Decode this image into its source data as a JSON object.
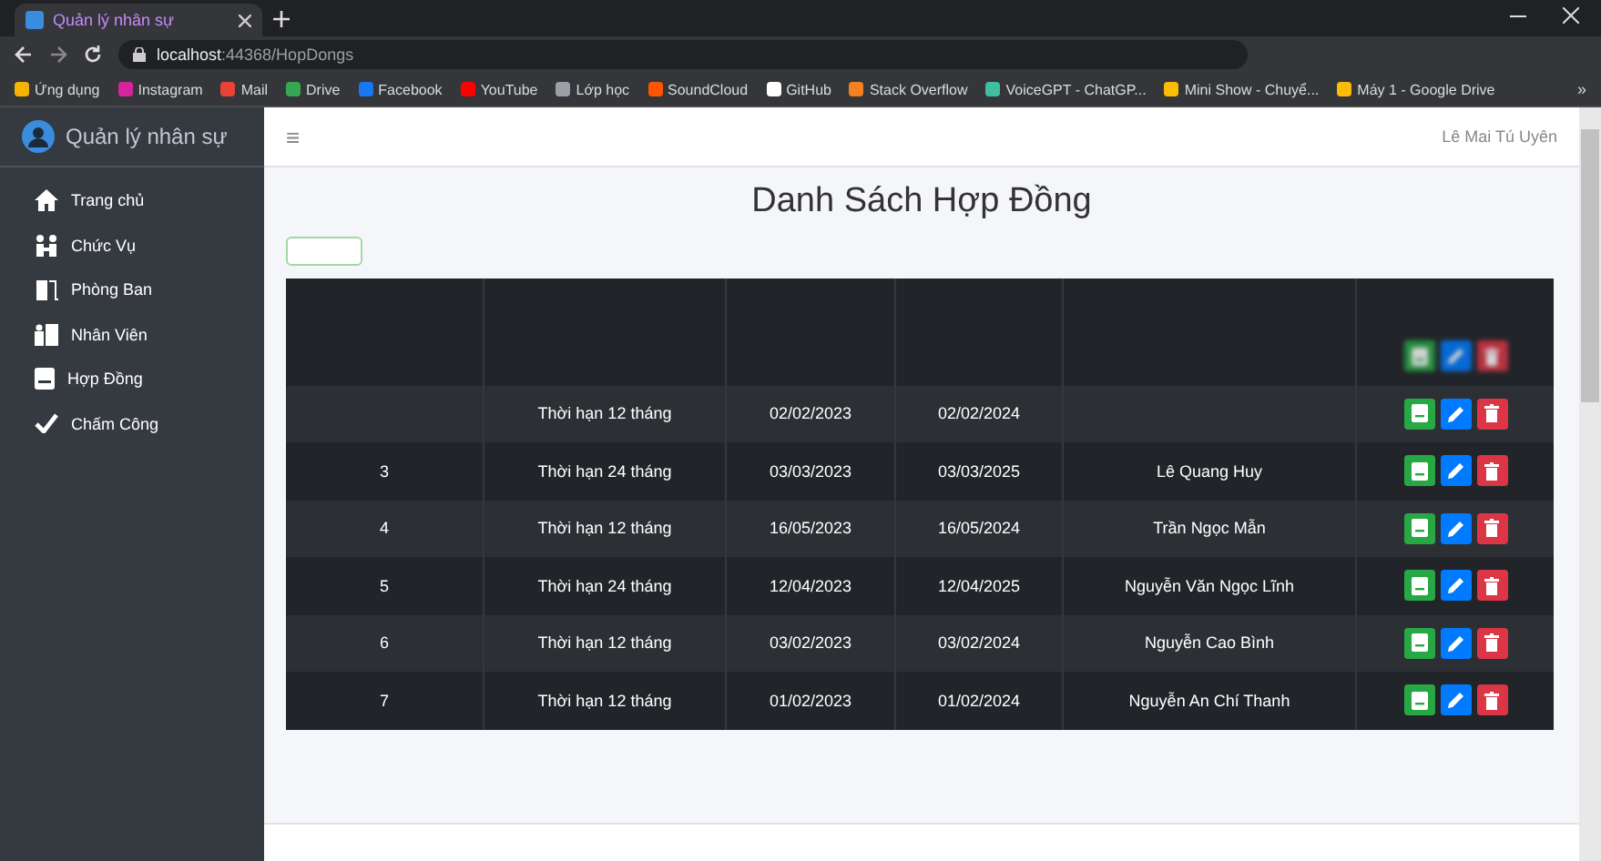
{
  "browser": {
    "tab_title": "Quản lý nhân sự",
    "url_host": "localhost",
    "url_path": ":44368/HopDongs",
    "bookmarks": [
      {
        "label": "Ứng dụng",
        "color": "#f4b400"
      },
      {
        "label": "Instagram",
        "color": "#d6249f"
      },
      {
        "label": "Mail",
        "color": "#ea4335"
      },
      {
        "label": "Drive",
        "color": "#34a853"
      },
      {
        "label": "Facebook",
        "color": "#1877f2"
      },
      {
        "label": "YouTube",
        "color": "#ff0000"
      },
      {
        "label": "Lớp học",
        "color": "#9aa0a6"
      },
      {
        "label": "SoundCloud",
        "color": "#ff5500"
      },
      {
        "label": "GitHub",
        "color": "#ffffff"
      },
      {
        "label": "Stack Overflow",
        "color": "#f48024"
      },
      {
        "label": "VoiceGPT - ChatGP...",
        "color": "#3fbf9f"
      },
      {
        "label": "Mini Show - Chuyể...",
        "color": "#fbbc04"
      },
      {
        "label": "Máy 1 - Google Drive",
        "color": "#fbbc05"
      }
    ],
    "more": "»"
  },
  "sidebar": {
    "brand": "Quản lý nhân sự",
    "items": [
      {
        "label": "Trang chủ",
        "kind": "home"
      },
      {
        "label": "Chức Vụ",
        "kind": "people"
      },
      {
        "label": "Phòng Ban",
        "kind": "door"
      },
      {
        "label": "Nhân Viên",
        "kind": "staff"
      },
      {
        "label": "Hợp Đồng",
        "kind": "book"
      },
      {
        "label": "Chấm Công",
        "kind": "check"
      }
    ]
  },
  "navbar": {
    "menu": "≡",
    "user": "Lê Mai Tú Uyên"
  },
  "page": {
    "title": "Danh Sách Hợp Đồng"
  },
  "table": {
    "rows": [
      {
        "blurred": true
      },
      {
        "type": "Thời hạn 12 tháng",
        "start": "02/02/2023",
        "end": "02/02/2024"
      },
      {
        "id": "3",
        "type": "Thời hạn 24 tháng",
        "start": "03/03/2023",
        "end": "03/03/2025",
        "employee": "Lê Quang Huy"
      },
      {
        "id": "4",
        "type": "Thời hạn 12 tháng",
        "start": "16/05/2023",
        "end": "16/05/2024",
        "employee": "Trần Ngọc Mẫn"
      },
      {
        "id": "5",
        "type": "Thời hạn 24 tháng",
        "start": "12/04/2023",
        "end": "12/04/2025",
        "employee": "Nguyễn Văn Ngọc Lĩnh"
      },
      {
        "id": "6",
        "type": "Thời hạn 12 tháng",
        "start": "03/02/2023",
        "end": "03/02/2024",
        "employee": "Nguyễn Cao Bình"
      },
      {
        "id": "7",
        "type": "Thời hạn 12 tháng",
        "start": "01/02/2023",
        "end": "01/02/2024",
        "employee": "Nguyễn An Chí Thanh"
      }
    ]
  }
}
